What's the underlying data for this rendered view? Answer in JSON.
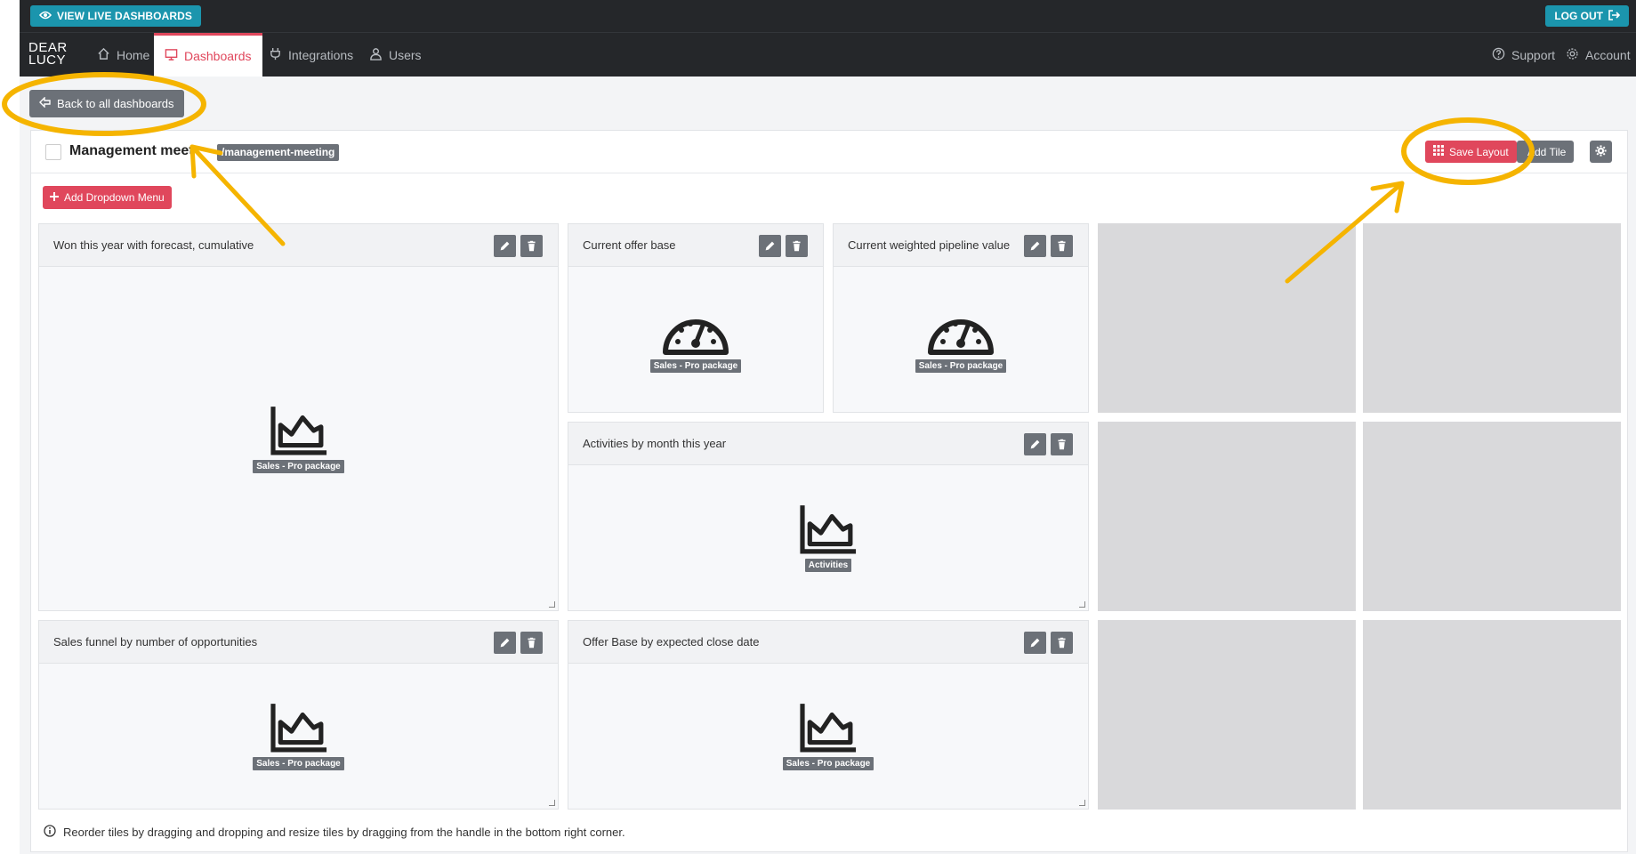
{
  "topbar": {
    "live_label": "VIEW LIVE DASHBOARDS",
    "logout_label": "LOG OUT"
  },
  "logo": {
    "line1": "DEAR",
    "line2": "LUCY"
  },
  "nav": {
    "items": [
      {
        "label": "Home",
        "icon": "home-icon"
      },
      {
        "label": "Dashboards",
        "icon": "monitor-icon",
        "active": true
      },
      {
        "label": "Integrations",
        "icon": "plug-icon"
      },
      {
        "label": "Users",
        "icon": "user-icon"
      }
    ],
    "right": [
      {
        "label": "Support",
        "icon": "question-circle-icon"
      },
      {
        "label": "Account",
        "icon": "gear-icon"
      }
    ]
  },
  "back_label": "Back to all dashboards",
  "dashboard": {
    "title": "Management meet",
    "slug": "/management-meeting",
    "save_label": "Save Layout",
    "addtile_label": "Add Tile",
    "dropdown_label": "Add Dropdown Menu",
    "help_text": "Reorder tiles by dragging and dropping and resize tiles by dragging from the handle in the bottom right corner."
  },
  "tiles": [
    {
      "title": "Won this year with forecast, cumulative",
      "tag": "Sales - Pro package",
      "icon": "area-chart-icon"
    },
    {
      "title": "Current offer base",
      "tag": "Sales - Pro package",
      "icon": "gauge-icon"
    },
    {
      "title": "Current weighted pipeline value",
      "tag": "Sales - Pro package",
      "icon": "gauge-icon"
    },
    {
      "title": "Activities by month this year",
      "tag": "Activities",
      "icon": "area-chart-icon"
    },
    {
      "title": "Sales funnel by number of opportunities",
      "tag": "Sales - Pro package",
      "icon": "area-chart-icon"
    },
    {
      "title": "Offer Base by expected close date",
      "tag": "Sales - Pro package",
      "icon": "area-chart-icon"
    }
  ],
  "colors": {
    "accent": "#e0475c",
    "teal": "#1b95ad",
    "dark": "#25272a",
    "annotation": "#f5b400"
  }
}
